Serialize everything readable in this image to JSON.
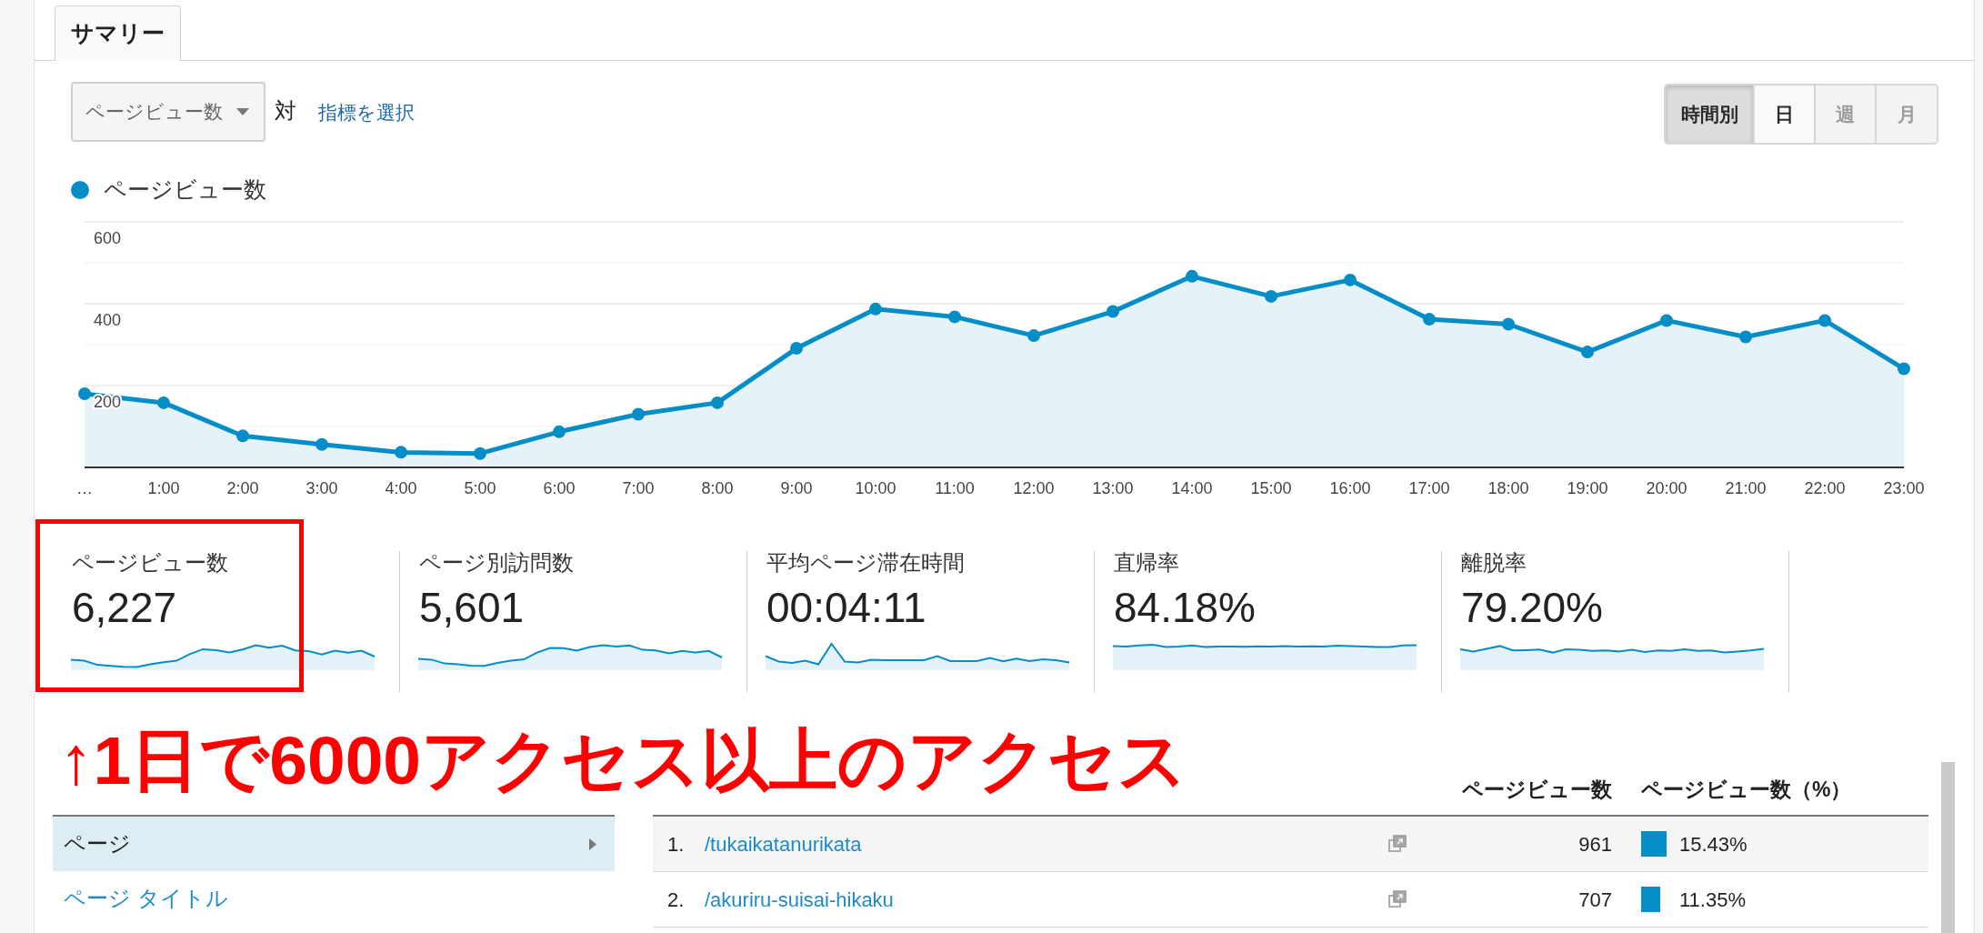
{
  "tabs": [
    {
      "label": "サマリー",
      "selected": true
    }
  ],
  "metric_selector": {
    "value": "ページビュー数",
    "vs_label": "対",
    "select_metric_link": "指標を選択"
  },
  "granularity_buttons": [
    {
      "label": "時間別",
      "selected": true,
      "disabled": false
    },
    {
      "label": "日",
      "selected": false,
      "disabled": false
    },
    {
      "label": "週",
      "selected": false,
      "disabled": true
    },
    {
      "label": "月",
      "selected": false,
      "disabled": true
    }
  ],
  "chart": {
    "chart_data": {
      "type": "area",
      "categories": [
        "…",
        "1:00",
        "2:00",
        "3:00",
        "4:00",
        "5:00",
        "6:00",
        "7:00",
        "8:00",
        "9:00",
        "10:00",
        "11:00",
        "12:00",
        "13:00",
        "14:00",
        "15:00",
        "16:00",
        "17:00",
        "18:00",
        "19:00",
        "20:00",
        "21:00",
        "22:00",
        "23:00"
      ],
      "series": [
        {
          "name": "ページビュー数",
          "color": "#058dc7",
          "values": [
            180,
            158,
            77,
            56,
            37,
            34,
            87,
            130,
            158,
            291,
            387,
            368,
            322,
            381,
            467,
            418,
            458,
            362,
            350,
            282,
            359,
            319,
            359,
            241
          ]
        }
      ],
      "ylim": [
        0,
        600
      ],
      "yticks": [
        200,
        400,
        600
      ]
    }
  },
  "metrics": [
    {
      "label": "ページビュー数",
      "value": "6,227",
      "highlighted": true
    },
    {
      "label": "ページ別訪問数",
      "value": "5,601",
      "highlighted": false
    },
    {
      "label": "平均ページ滞在時間",
      "value": "00:04:11",
      "highlighted": false
    },
    {
      "label": "直帰率",
      "value": "84.18%",
      "highlighted": false
    },
    {
      "label": "離脱率",
      "value": "79.20%",
      "highlighted": false
    }
  ],
  "annotation": {
    "text": "↑1日で6000アクセス以上のアクセス"
  },
  "site_content": [
    {
      "label": "ページ",
      "selected": true
    },
    {
      "label": "ページ タイトル",
      "selected": false
    }
  ],
  "table": {
    "columns": [
      "ページビュー数",
      "ページビュー数（%）"
    ],
    "rows": [
      {
        "rank": "1.",
        "page": "/tukaikatanurikata",
        "pageviews": "961",
        "percent": "15.43%"
      },
      {
        "rank": "2.",
        "page": "/akuriru-suisai-hikaku",
        "pageviews": "707",
        "percent": "11.35%"
      }
    ]
  }
}
